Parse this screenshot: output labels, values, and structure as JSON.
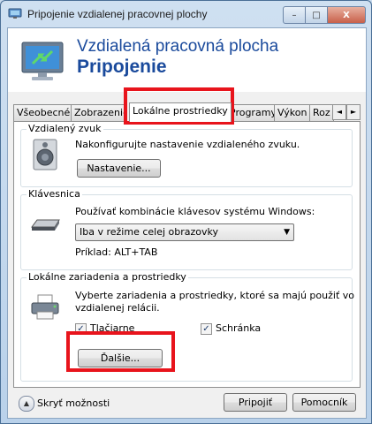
{
  "window": {
    "title": "Pripojenie vzdialenej pracovnej plochy",
    "close_glyph": "X",
    "minimize_glyph": "–",
    "maximize_glyph": "□"
  },
  "banner": {
    "line1": "Vzdialená pracovná plocha",
    "line2": "Pripojenie"
  },
  "tabs": [
    {
      "label": "Všeobecné"
    },
    {
      "label": "Zobrazenie"
    },
    {
      "label": "Lokálne prostriedky",
      "active": true
    },
    {
      "label": "Programy"
    },
    {
      "label": "Výkon"
    },
    {
      "label": "Roz"
    }
  ],
  "tab_scroll": {
    "left": "◄",
    "right": "►"
  },
  "sound": {
    "group_label": "Vzdialený zvuk",
    "description": "Nakonfigurujte nastavenie vzdialeného zvuku.",
    "settings_button": "Nastavenie..."
  },
  "keyboard": {
    "group_label": "Klávesnica",
    "description": "Používať kombinácie klávesov systému Windows:",
    "selected": "Iba v režime celej obrazovky",
    "dropdown_arrow": "▼",
    "example": "Príklad: ALT+TAB"
  },
  "devices": {
    "group_label": "Lokálne zariadenia a prostriedky",
    "description_line1": "Vyberte zariadenia a prostriedky, ktoré sa majú použiť vo",
    "description_line2": "vzdialenej relácii.",
    "printers_label": "Tlačiarne",
    "printers_checked": true,
    "clipboard_label": "Schránka",
    "clipboard_checked": true,
    "check_glyph": "✓",
    "more_button": "Ďalšie..."
  },
  "footer": {
    "options_toggle": "Skryť možnosti",
    "options_glyph": "▲",
    "connect_button": "Pripojiť",
    "help_button": "Pomocník"
  },
  "colors": {
    "accent_title": "#1a4a9c",
    "highlight": "#e8141c"
  }
}
